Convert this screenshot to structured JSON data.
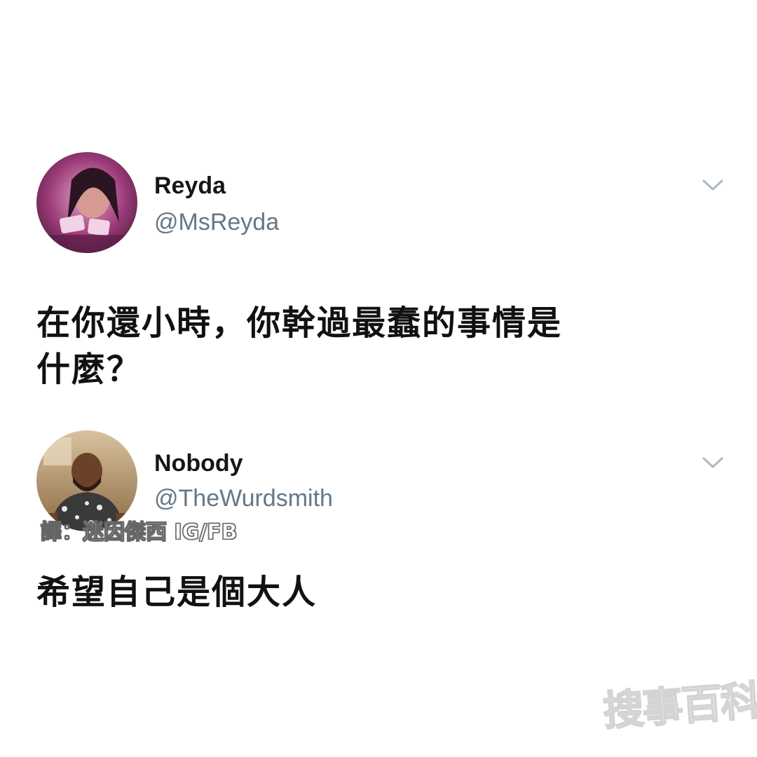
{
  "tweets": [
    {
      "display_name": "Reyda",
      "handle": "@MsReyda",
      "text_lines": [
        "在你還小時，你幹過最蠢的事情是",
        "什麼？"
      ]
    },
    {
      "display_name": "Nobody",
      "handle": "@TheWurdsmith",
      "text_lines": [
        "希望自己是個大人"
      ]
    }
  ],
  "icons": {
    "menu": "chevron-down-icon"
  },
  "overlays": {
    "translator_credit": "譯：迷因傑西 IG/FB",
    "watermark": "搜事百科"
  },
  "colors": {
    "handle": "#657786",
    "name": "#14171a",
    "chevron": "#aab8c2"
  }
}
